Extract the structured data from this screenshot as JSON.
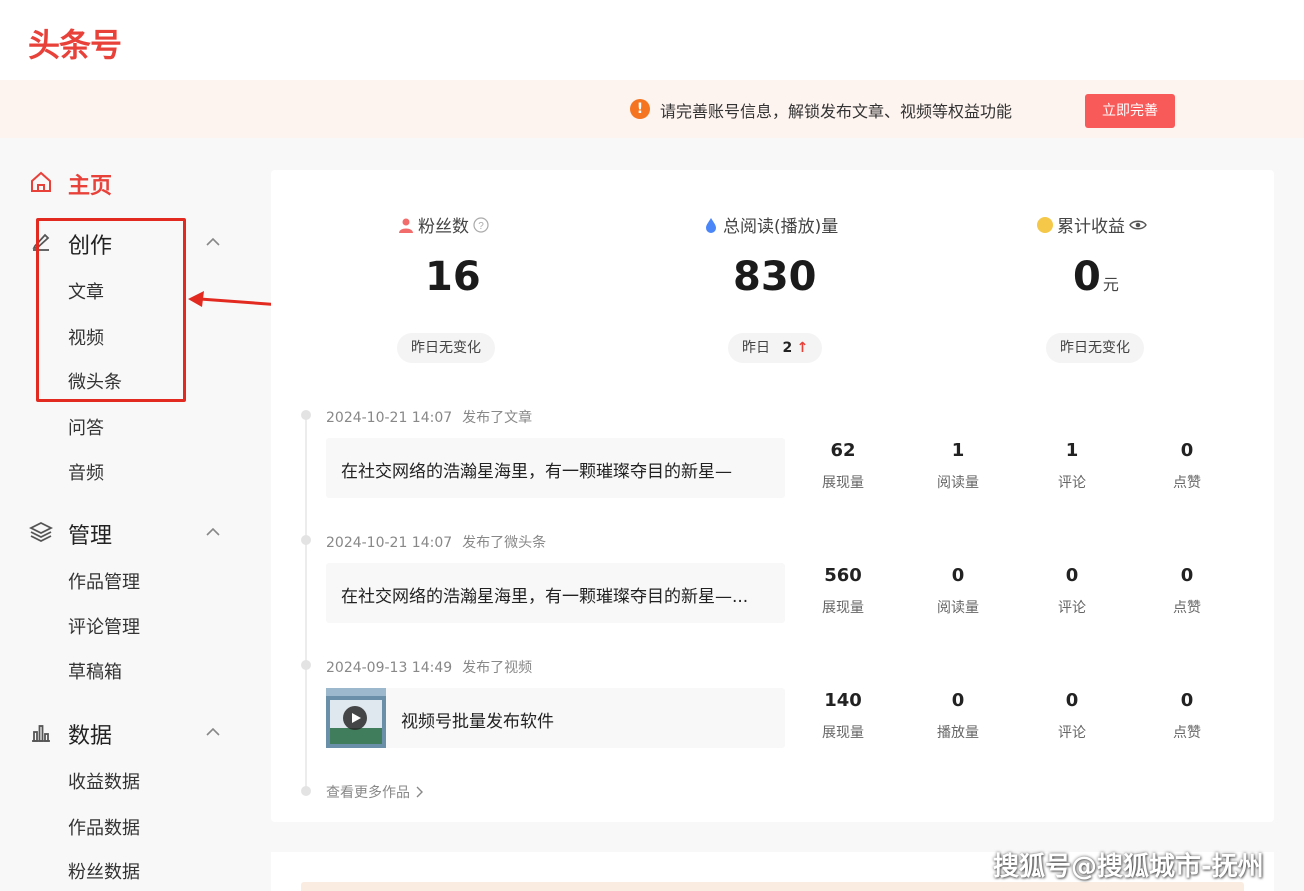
{
  "logo": "头条号",
  "notice": {
    "icon": "!",
    "text": "请完善账号信息，解锁发布文章、视频等权益功能",
    "button": "立即完善"
  },
  "sidebar": {
    "home": "主页",
    "create": {
      "title": "创作",
      "items": [
        "文章",
        "视频",
        "微头条",
        "问答",
        "音频"
      ]
    },
    "manage": {
      "title": "管理",
      "items": [
        "作品管理",
        "评论管理",
        "草稿箱"
      ]
    },
    "data": {
      "title": "数据",
      "items": [
        "收益数据",
        "作品数据",
        "粉丝数据"
      ]
    }
  },
  "stats": {
    "fans": {
      "label": "粉丝数",
      "value": "16",
      "note": "昨日无变化"
    },
    "reads": {
      "label": "总阅读(播放)量",
      "value": "830",
      "note_prefix": "昨日",
      "note_value": "2",
      "note_arrow": "↑"
    },
    "income": {
      "label": "累计收益",
      "value": "0",
      "unit": "元",
      "note": "昨日无变化"
    }
  },
  "posts": [
    {
      "date": "2024-10-21 14:07",
      "action": "发布了文章",
      "title": "在社交网络的浩瀚星海里，有一颗璀璨夺目的新星—",
      "metrics": [
        {
          "value": "62",
          "label": "展现量"
        },
        {
          "value": "1",
          "label": "阅读量"
        },
        {
          "value": "1",
          "label": "评论"
        },
        {
          "value": "0",
          "label": "点赞"
        }
      ]
    },
    {
      "date": "2024-10-21 14:07",
      "action": "发布了微头条",
      "title": "在社交网络的浩瀚星海里，有一颗璀璨夺目的新星—...",
      "metrics": [
        {
          "value": "560",
          "label": "展现量"
        },
        {
          "value": "0",
          "label": "阅读量"
        },
        {
          "value": "0",
          "label": "评论"
        },
        {
          "value": "0",
          "label": "点赞"
        }
      ]
    },
    {
      "date": "2024-09-13 14:49",
      "action": "发布了视频",
      "title": "视频号批量发布软件",
      "metrics": [
        {
          "value": "140",
          "label": "展现量"
        },
        {
          "value": "0",
          "label": "播放量"
        },
        {
          "value": "0",
          "label": "评论"
        },
        {
          "value": "0",
          "label": "点赞"
        }
      ]
    }
  ],
  "more_link": "查看更多作品",
  "watermark": "搜狐号@搜狐城市-抚州",
  "colors": {
    "brand": "#e8413a",
    "button": "#f85959",
    "notice_bg": "#fdf3ef",
    "annotation": "#e32a20"
  }
}
